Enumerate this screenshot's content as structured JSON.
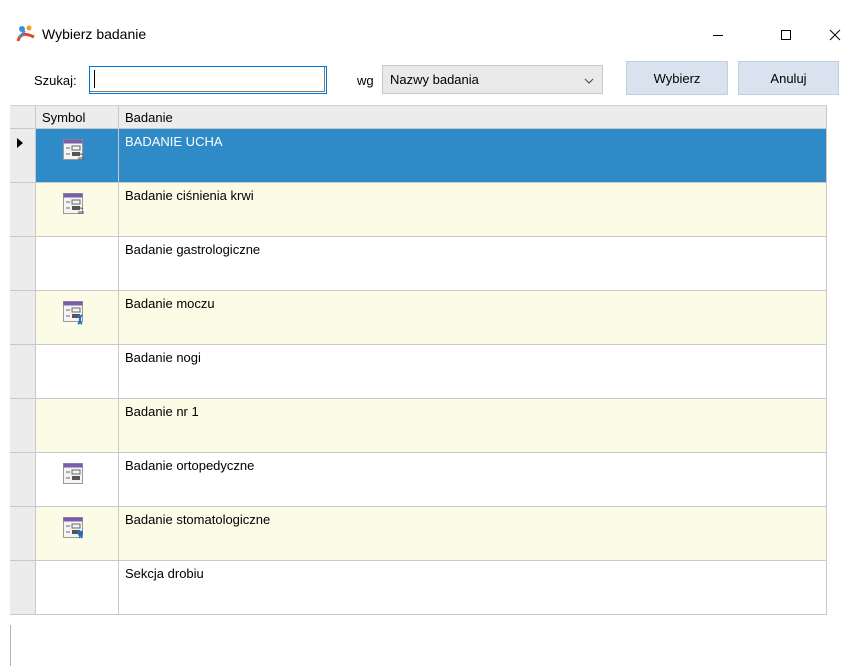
{
  "window": {
    "title": "Wybierz badanie"
  },
  "toolbar": {
    "search_label": "Szukaj:",
    "search_value": "",
    "wg_label": "wg",
    "sort_by_value": "Nazwy badania",
    "select_button": "Wybierz",
    "cancel_button": "Anuluj"
  },
  "grid": {
    "columns": [
      "Symbol",
      "Badanie"
    ],
    "rows": [
      {
        "name": "BADANIE UCHA",
        "icon": "exam-ear-icon",
        "selected": true
      },
      {
        "name": "Badanie ciśnienia krwi",
        "icon": "exam-ear-icon",
        "selected": false
      },
      {
        "name": "Badanie gastrologiczne",
        "icon": "",
        "selected": false
      },
      {
        "name": "Badanie moczu",
        "icon": "exam-dna-icon",
        "selected": false
      },
      {
        "name": "Badanie nogi",
        "icon": "",
        "selected": false
      },
      {
        "name": "Badanie nr 1",
        "icon": "",
        "selected": false
      },
      {
        "name": "Badanie ortopedyczne",
        "icon": "exam-plain-icon",
        "selected": false
      },
      {
        "name": "Badanie stomatologiczne",
        "icon": "exam-tooth-icon",
        "selected": false
      },
      {
        "name": "Sekcja drobiu",
        "icon": "",
        "selected": false
      }
    ]
  },
  "colors": {
    "selected_row": "#2e8bc8",
    "alt_row": "#fcfce6",
    "button_bg": "#d9e3f0",
    "icon_purple": "#7b5ea7"
  }
}
